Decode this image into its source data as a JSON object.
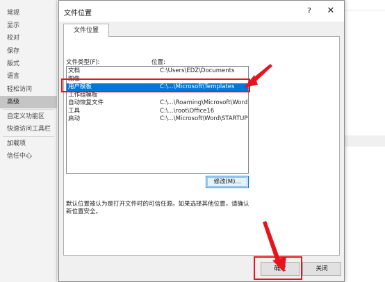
{
  "sidebar": {
    "items": [
      {
        "label": "常规"
      },
      {
        "label": "显示"
      },
      {
        "label": "校对"
      },
      {
        "label": "保存"
      },
      {
        "label": "版式"
      },
      {
        "label": "语言"
      },
      {
        "label": "轻松访问"
      },
      {
        "label": "高级",
        "selected": true
      },
      {
        "label": "自定义功能区"
      },
      {
        "label": "快速访问工具栏"
      },
      {
        "label": "加载项"
      },
      {
        "label": "信任中心"
      }
    ]
  },
  "dialog": {
    "title": "文件位置",
    "help_label": "?",
    "close_label": "✕",
    "tab_label": "文件位置",
    "col_type_header": "文件类型(F):",
    "col_location_header": "位置:",
    "rows": [
      {
        "type": "文档",
        "location": "C:\\Users\\EDZ\\Documents"
      },
      {
        "type": "图像",
        "location": ""
      },
      {
        "type": "用户模板",
        "location": "C:\\...\\Microsoft\\Templates",
        "selected": true
      },
      {
        "type": "工作组模板",
        "location": ""
      },
      {
        "type": "自动恢复文件",
        "location": "C:\\...\\Roaming\\Microsoft\\Word"
      },
      {
        "type": "工具",
        "location": "C:\\...\\root\\Office16"
      },
      {
        "type": "启动",
        "location": "C:\\...\\Microsoft\\Word\\STARTUP"
      }
    ],
    "modify_label": "修改(M)...",
    "note_text": "默认位置被认为是打开文件时的可信任源。如果选择其他位置，请确认新位置安全。",
    "ok_label": "确定",
    "cancel_label": "关闭"
  },
  "colors": {
    "selection": "#0078d7",
    "annotation": "#e8141d"
  }
}
